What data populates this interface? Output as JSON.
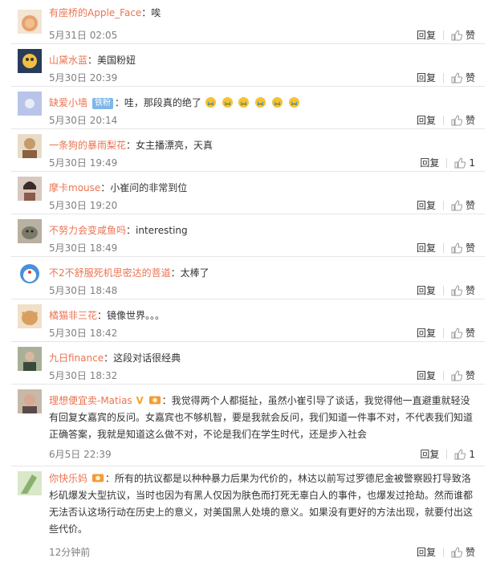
{
  "ui": {
    "reply_label": "回复",
    "like_label": "赞",
    "colors": {
      "username": "#eb7350",
      "meta": "#808080",
      "divider": "#e6e6e6"
    }
  },
  "comments": [
    {
      "user": "有座桥的Apple_Face",
      "text": "唉",
      "time": "5月31日 02:05",
      "likes": "",
      "avatar_color": "#e8a070"
    },
    {
      "user": "山黛水蓝",
      "text": "美国粉妞",
      "time": "5月30日 20:39",
      "likes": "",
      "avatar_color": "#6fa0c0"
    },
    {
      "user": "缺爱小墙",
      "badge": "铁粉",
      "text": "哇，那段真的绝了",
      "emoji_count": 6,
      "emoji_icon": "crying-face-icon",
      "time": "5月30日 20:14",
      "likes": "",
      "avatar_color": "#b8c4e8"
    },
    {
      "user": "一条狗的暴雨梨花",
      "text": "女主播漂亮，天真",
      "time": "5月30日 19:49",
      "likes": "1",
      "avatar_color": "#c79a6a"
    },
    {
      "user": "摩卡mouse",
      "text": "小崔问的非常到位",
      "time": "5月30日 19:20",
      "likes": "",
      "avatar_color": "#8a5a4a"
    },
    {
      "user": "不努力会变咸鱼吗",
      "text": "interesting",
      "time": "5月30日 18:49",
      "likes": "",
      "avatar_color": "#7a7a6a"
    },
    {
      "user": "不2不舒服死机思密达的菩道",
      "text": "太棒了",
      "time": "5月30日 18:48",
      "likes": "",
      "avatar_color": "#4a90d9"
    },
    {
      "user": "橘猫非三花",
      "text": "镜像世界。。。",
      "time": "5月30日 18:42",
      "likes": "",
      "avatar_color": "#d8a060"
    },
    {
      "user": "九日finance",
      "text": "这段对话很经典",
      "time": "5月30日 18:32",
      "likes": "",
      "avatar_color": "#5a6a4a"
    },
    {
      "user": "理想便宜卖-Matias",
      "verified": "V",
      "medal": true,
      "text": "我觉得两个人都挺扯，虽然小崔引导了谈话，我觉得他一直避重就轻没有回复女嘉宾的反问。女嘉宾也不够机智，要是我就会反问，我们知道一件事不对，不代表我们知道正确答案，我就是知道这么做不对，不论是我们在学生时代，还是步入社会",
      "time": "6月5日 22:39",
      "likes": "1",
      "avatar_color": "#9a6a5a"
    },
    {
      "user": "你快乐妈",
      "medal": true,
      "text": "所有的抗议都是以种种暴力后果为代价的，林达以前写过罗德尼金被警察殴打导致洛杉矶爆发大型抗议，当时也因为有黑人仅因为肤色而打死无辜白人的事件，也爆发过抢劫。然而谁都无法否认这场行动在历史上的意义，对美国黑人处境的意义。如果没有更好的方法出现，就要付出这些代价。",
      "time": "12分钟前",
      "likes": "",
      "avatar_color": "#8ab070"
    }
  ]
}
